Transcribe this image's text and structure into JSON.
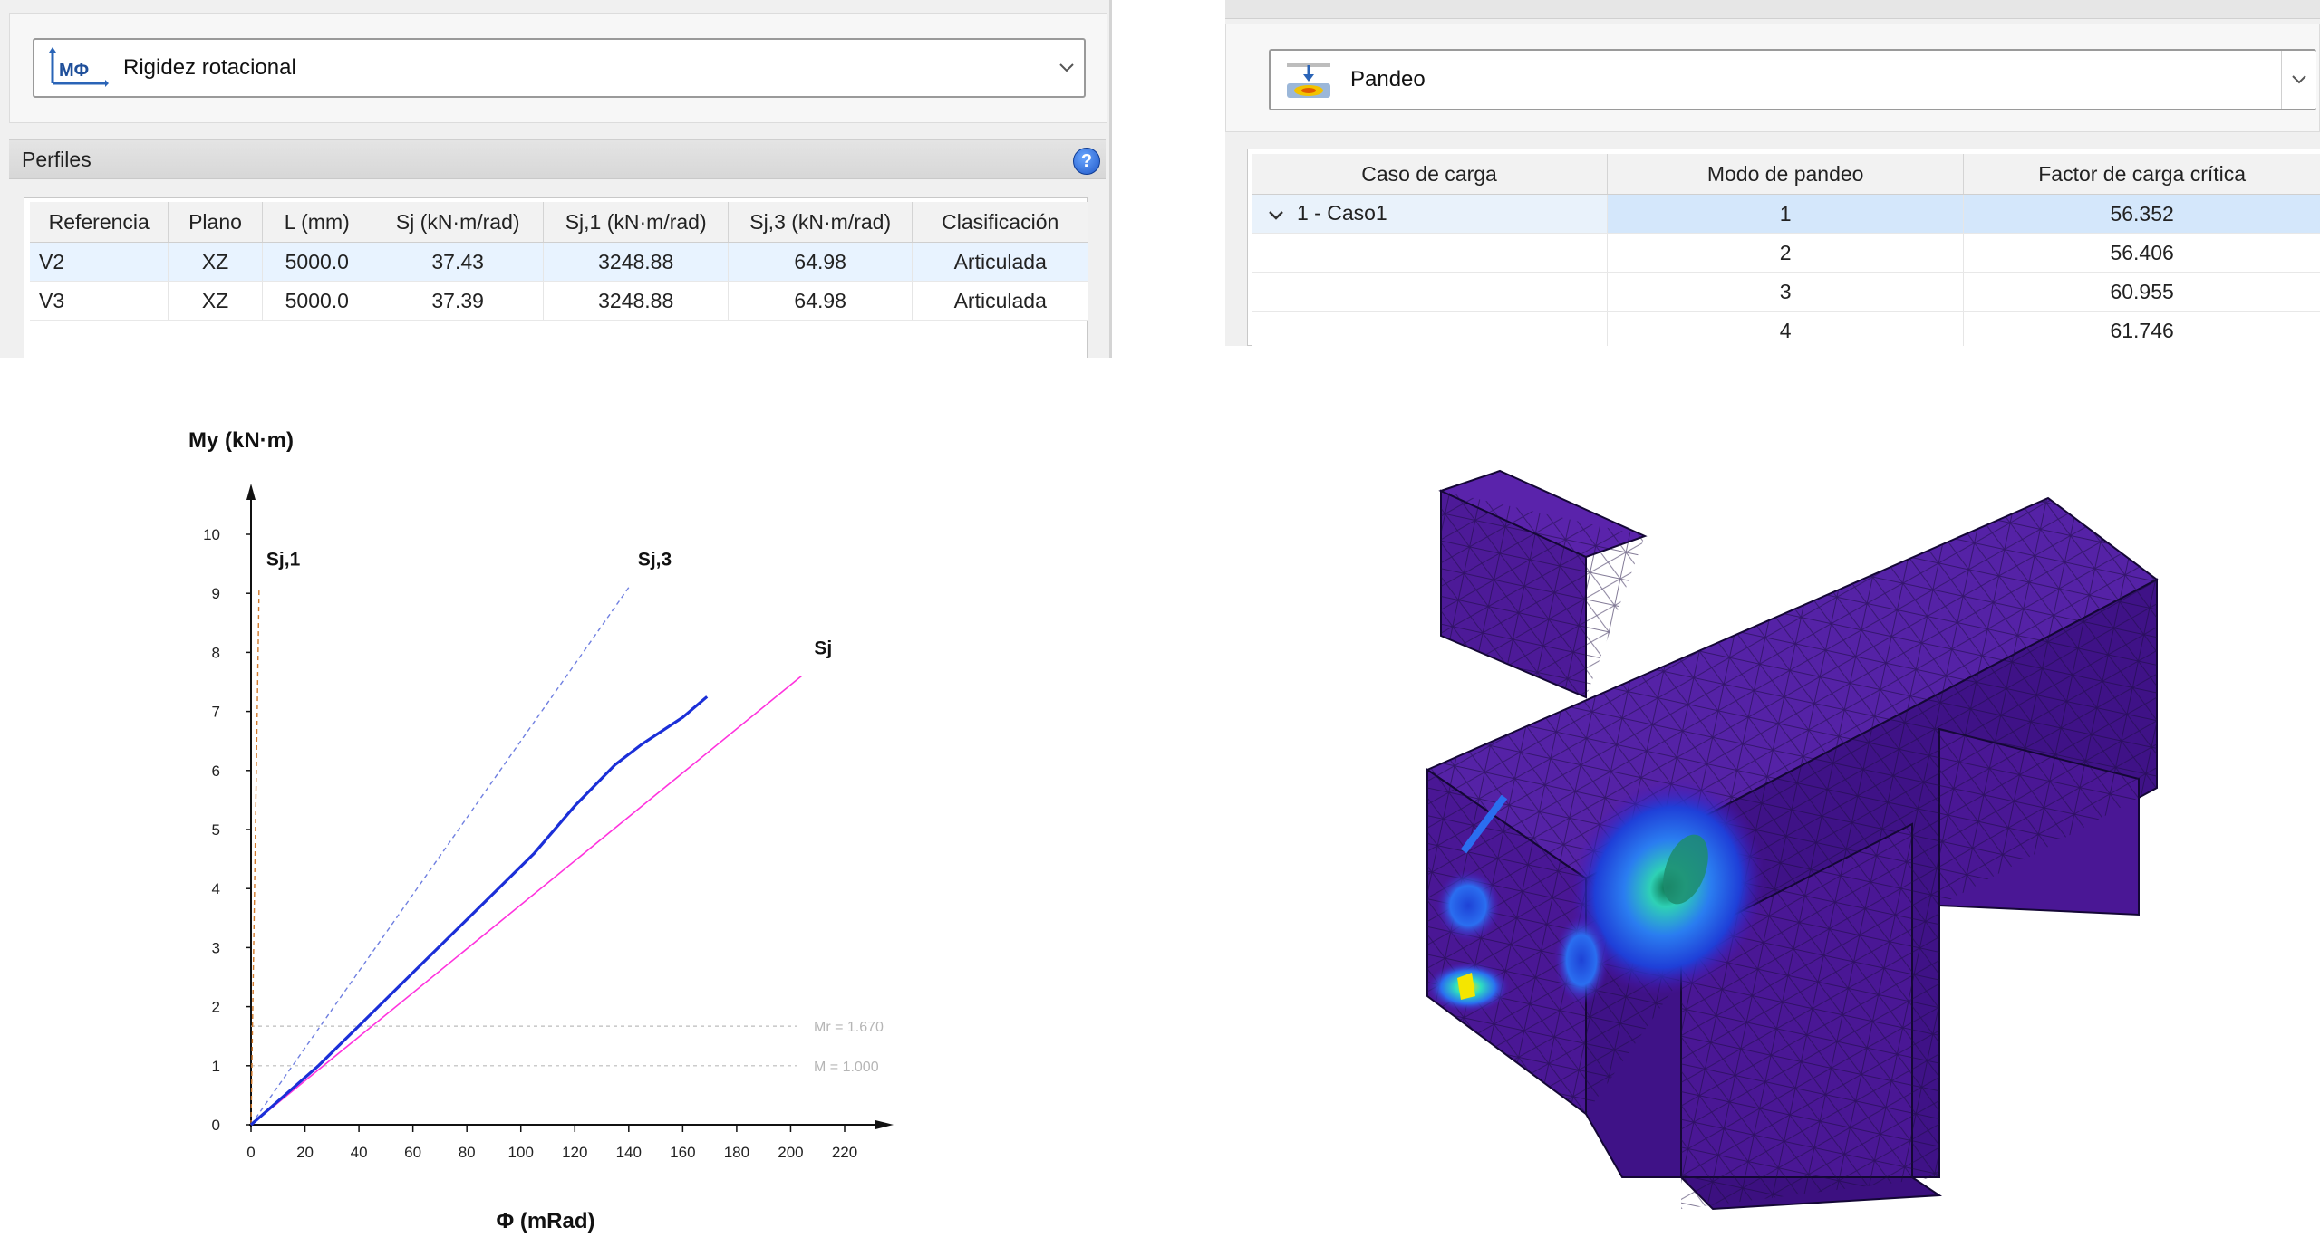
{
  "left_panel": {
    "combo": {
      "icon": "rotational-stiffness-icon",
      "icon_text": "MΦ",
      "label": "Rigidez rotacional"
    },
    "group_title": "Perfiles",
    "help_icon": "help-icon",
    "help_text": "?",
    "columns": [
      "Referencia",
      "Plano",
      "L (mm)",
      "Sj (kN·m/rad)",
      "Sj,1 (kN·m/rad)",
      "Sj,3 (kN·m/rad)",
      "Clasificación"
    ],
    "rows": [
      [
        "V2",
        "XZ",
        "5000.0",
        "37.43",
        "3248.88",
        "64.98",
        "Articulada"
      ],
      [
        "V3",
        "XZ",
        "5000.0",
        "37.39",
        "3248.88",
        "64.98",
        "Articulada"
      ]
    ]
  },
  "right_panel": {
    "combo": {
      "icon": "buckling-icon",
      "label": "Pandeo"
    },
    "columns": [
      "Caso de carga",
      "Modo de pandeo",
      "Factor de carga crítica"
    ],
    "case_label": "1 - Caso1",
    "rows": [
      {
        "mode": "1",
        "factor": "56.352"
      },
      {
        "mode": "2",
        "factor": "56.406"
      },
      {
        "mode": "3",
        "factor": "60.955"
      },
      {
        "mode": "4",
        "factor": "61.746"
      }
    ]
  },
  "chart_data": {
    "type": "line",
    "title": "",
    "xlabel": "Φ (mRad)",
    "ylabel": "My (kN·m)",
    "xlim": [
      0,
      220
    ],
    "ylim": [
      0,
      10
    ],
    "xticks": [
      0,
      20,
      40,
      60,
      80,
      100,
      120,
      140,
      160,
      180,
      200,
      220
    ],
    "yticks": [
      0,
      1,
      2,
      3,
      4,
      5,
      6,
      7,
      8,
      9,
      10
    ],
    "series": [
      {
        "name": "Sj,1",
        "style": "dashed",
        "color": "#d27a2c",
        "points": [
          [
            0,
            0
          ],
          [
            3,
            9.1
          ]
        ]
      },
      {
        "name": "Sj,3",
        "style": "dashed",
        "color": "#6f7fe0",
        "points": [
          [
            0,
            0
          ],
          [
            140,
            9.1
          ]
        ]
      },
      {
        "name": "Sj",
        "style": "solid",
        "color": "#ff33dd",
        "points": [
          [
            0,
            0
          ],
          [
            204,
            7.6
          ]
        ]
      },
      {
        "name": "",
        "style": "solid",
        "color": "#1b2fd8",
        "points": [
          [
            0,
            0
          ],
          [
            10,
            0.4
          ],
          [
            25,
            1.0
          ],
          [
            45,
            1.9
          ],
          [
            65,
            2.8
          ],
          [
            85,
            3.7
          ],
          [
            105,
            4.6
          ],
          [
            120,
            5.4
          ],
          [
            135,
            6.1
          ],
          [
            145,
            6.45
          ],
          [
            160,
            6.9
          ],
          [
            169,
            7.25
          ]
        ]
      }
    ],
    "hlines": [
      {
        "y": 1.67,
        "label": "Mr = 1.670"
      },
      {
        "y": 1.0,
        "label": "M = 1.000"
      }
    ]
  },
  "fem_view": {
    "description_icon": "fem-stress-contour-icon"
  }
}
